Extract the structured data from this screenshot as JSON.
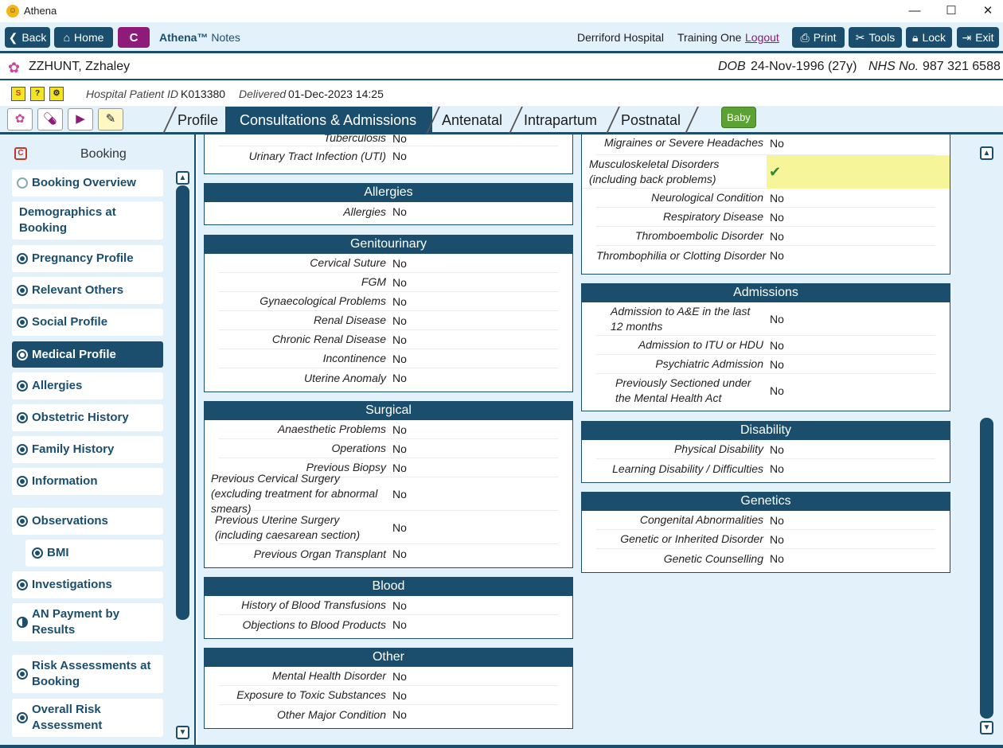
{
  "window": {
    "title": "Athena",
    "app_icon": "athena-logo-icon",
    "minimize": "—",
    "maximize": "☐",
    "close": "✕"
  },
  "toolbar": {
    "back": "Back",
    "home": "Home",
    "c_label": "C",
    "app_name_bold": "Athena™",
    "app_name": "Notes",
    "hospital": "Derriford Hospital",
    "user": "Training One",
    "logout": "Logout",
    "print": "Print",
    "tools": "Tools",
    "lock": "Lock",
    "exit": "Exit"
  },
  "patient": {
    "name": "ZZHUNT, Zzhaley",
    "dob_label": "DOB",
    "dob": "24-Nov-1996 (27y)",
    "nhs_label": "NHS No.",
    "nhs": "987 321 6588",
    "hpid_label": "Hospital Patient ID",
    "hpid": "K013380",
    "delivered_label": "Delivered",
    "delivered": "01-Dec-2023 14:25"
  },
  "tabs": [
    {
      "label": "Profile",
      "active": false
    },
    {
      "label": "Consultations & Admissions",
      "active": true
    },
    {
      "label": "Antenatal",
      "active": false
    },
    {
      "label": "Intrapartum",
      "active": false
    },
    {
      "label": "Postnatal",
      "active": false
    }
  ],
  "baby_button": "Baby",
  "sidebar": {
    "title": "Booking",
    "items": [
      {
        "label": "Booking Overview"
      },
      {
        "label": "Demographics at Booking"
      },
      {
        "label": "Pregnancy Profile"
      },
      {
        "label": "Relevant Others"
      },
      {
        "label": "Social Profile"
      },
      {
        "label": "Medical Profile"
      },
      {
        "label": "Allergies"
      },
      {
        "label": "Obstetric History"
      },
      {
        "label": "Family History"
      },
      {
        "label": "Information"
      },
      {
        "label": "Observations"
      },
      {
        "label": "BMI"
      },
      {
        "label": "Investigations"
      },
      {
        "label": "AN Payment by Results"
      },
      {
        "label": "Risk Assessments at Booking"
      },
      {
        "label": "Overall Risk Assessment"
      }
    ]
  },
  "left_col": {
    "top_partial": {
      "rows": [
        {
          "label": "Tuberculosis",
          "value": "No"
        },
        {
          "label": "Urinary Tract Infection (UTI)",
          "value": "No"
        }
      ]
    },
    "allergies": {
      "title": "Allergies",
      "rows": [
        {
          "label": "Allergies",
          "value": "No"
        }
      ]
    },
    "genitourinary": {
      "title": "Genitourinary",
      "rows": [
        {
          "label": "Cervical Suture",
          "value": "No"
        },
        {
          "label": "FGM",
          "value": "No"
        },
        {
          "label": "Gynaecological Problems",
          "value": "No"
        },
        {
          "label": "Renal Disease",
          "value": "No"
        },
        {
          "label": "Chronic Renal Disease",
          "value": "No"
        },
        {
          "label": "Incontinence",
          "value": "No"
        },
        {
          "label": "Uterine Anomaly",
          "value": "No"
        }
      ]
    },
    "surgical": {
      "title": "Surgical",
      "rows": [
        {
          "label": "Anaesthetic Problems",
          "value": "No"
        },
        {
          "label": "Operations",
          "value": "No"
        },
        {
          "label": "Previous Biopsy",
          "value": "No"
        },
        {
          "label": "Previous Cervical Surgery (excluding treatment for abnormal smears)",
          "value": "No"
        },
        {
          "label": "Previous Uterine Surgery (including caesarean section)",
          "value": "No"
        },
        {
          "label": "Previous Organ Transplant",
          "value": "No"
        }
      ]
    },
    "blood": {
      "title": "Blood",
      "rows": [
        {
          "label": "History of Blood Transfusions",
          "value": "No"
        },
        {
          "label": "Objections to Blood Products",
          "value": "No"
        }
      ]
    },
    "other": {
      "title": "Other",
      "rows": [
        {
          "label": "Mental Health Disorder",
          "value": "No"
        },
        {
          "label": "Exposure to Toxic Substances",
          "value": "No"
        },
        {
          "label": "Other Major Condition",
          "value": "No"
        }
      ]
    }
  },
  "right_col": {
    "top_partial": {
      "rows": [
        {
          "label": "Migraines or Severe Headaches",
          "value": "No"
        },
        {
          "label": "Musculoskeletal Disorders (including back problems)",
          "value": "✔",
          "highlight": true
        },
        {
          "label": "Neurological Condition",
          "value": "No"
        },
        {
          "label": "Respiratory Disease",
          "value": "No"
        },
        {
          "label": "Thromboembolic Disorder",
          "value": "No"
        },
        {
          "label": "Thrombophilia or Clotting Disorder",
          "value": "No"
        }
      ]
    },
    "admissions": {
      "title": "Admissions",
      "rows": [
        {
          "label": "Admission to A&E in the last 12 months",
          "value": "No"
        },
        {
          "label": "Admission to ITU or HDU",
          "value": "No"
        },
        {
          "label": "Psychiatric Admission",
          "value": "No"
        },
        {
          "label": "Previously Sectioned under the Mental Health Act",
          "value": "No"
        }
      ]
    },
    "disability": {
      "title": "Disability",
      "rows": [
        {
          "label": "Physical Disability",
          "value": "No"
        },
        {
          "label": "Learning Disability / Difficulties",
          "value": "No"
        }
      ]
    },
    "genetics": {
      "title": "Genetics",
      "rows": [
        {
          "label": "Congenital Abnormalities",
          "value": "No"
        },
        {
          "label": "Genetic or Inherited Disorder",
          "value": "No"
        },
        {
          "label": "Genetic Counselling",
          "value": "No"
        }
      ]
    }
  },
  "colors": {
    "primary": "#1b4e6d",
    "accent": "#8e1a7a",
    "background": "#e3f1fb",
    "highlight": "#f7f59a",
    "check": "#2e8b3a",
    "baby": "#5ba233"
  }
}
